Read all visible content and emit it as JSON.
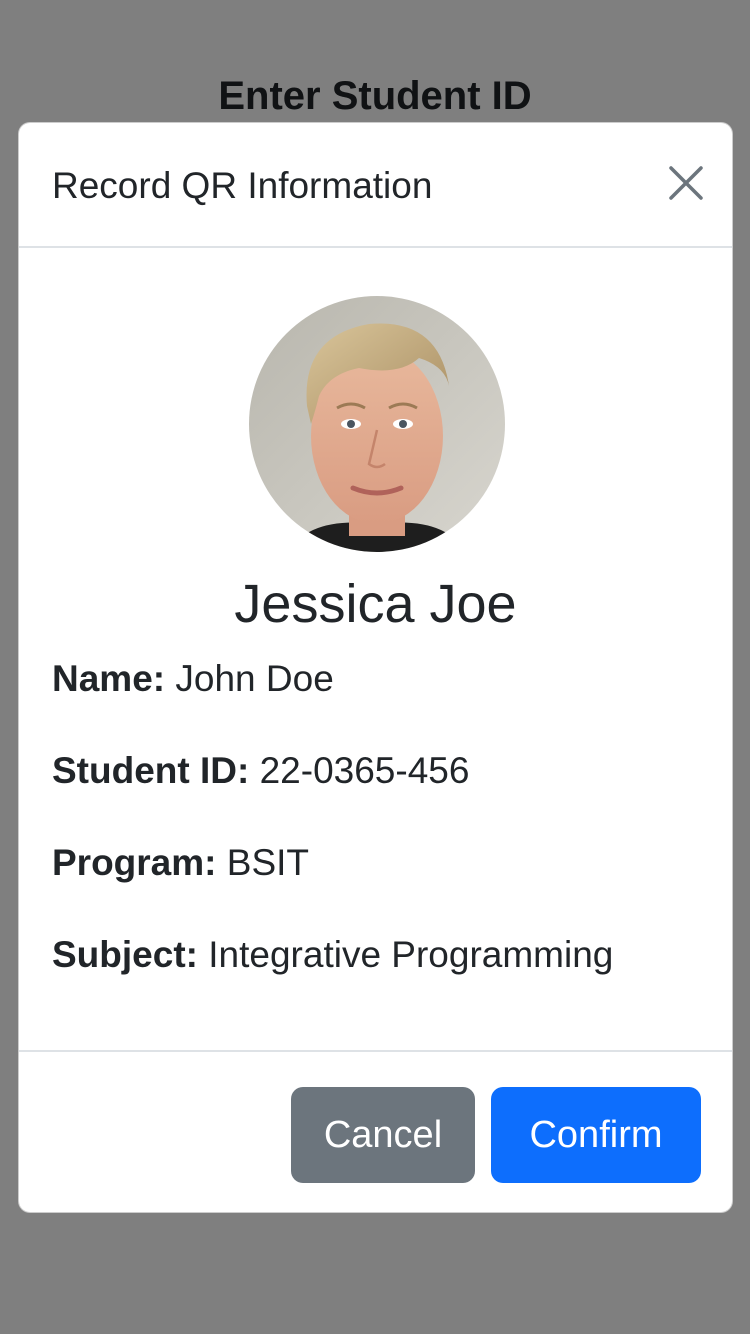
{
  "background": {
    "title": "Enter Student ID"
  },
  "modal": {
    "title": "Record QR Information",
    "close_icon": "close-icon",
    "display_name": "Jessica Joe",
    "fields": [
      {
        "label": "Name:",
        "value": "John Doe"
      },
      {
        "label": "Student ID:",
        "value": "22-0365-456"
      },
      {
        "label": "Program:",
        "value": "BSIT"
      },
      {
        "label": "Subject:",
        "value": "Integrative Programming"
      }
    ],
    "buttons": {
      "cancel": "Cancel",
      "confirm": "Confirm"
    }
  },
  "colors": {
    "primary": "#0d6efd",
    "secondary": "#6c757d",
    "backdrop": "#808080"
  }
}
